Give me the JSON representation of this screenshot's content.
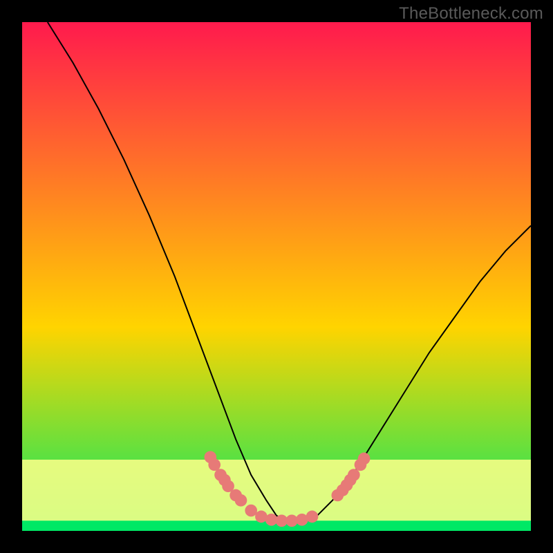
{
  "watermark": "TheBottleneck.com",
  "chart_data": {
    "type": "line",
    "title": "",
    "xlabel": "",
    "ylabel": "",
    "xlim": [
      0,
      100
    ],
    "ylim": [
      0,
      100
    ],
    "grid": false,
    "legend": false,
    "background_gradient": {
      "top_color": "#ff1a4d",
      "mid_color": "#ffd400",
      "bottom_color": "#00e865"
    },
    "series": [
      {
        "name": "curve",
        "color": "#000000",
        "x": [
          5,
          10,
          15,
          20,
          25,
          30,
          33,
          36,
          39,
          42,
          45,
          48,
          50,
          52,
          55,
          58,
          61,
          65,
          70,
          75,
          80,
          85,
          90,
          95,
          100
        ],
        "values": [
          100,
          92,
          83,
          73,
          62,
          50,
          42,
          34,
          26,
          18,
          11,
          6,
          3,
          2,
          2,
          3,
          6,
          11,
          19,
          27,
          35,
          42,
          49,
          55,
          60
        ]
      }
    ],
    "highlight_band": {
      "y_min": 0,
      "y_max": 14,
      "color": "#ffff8a"
    },
    "baseline_band": {
      "y_min": 0,
      "y_max": 2,
      "color": "#00e865"
    },
    "markers": {
      "color": "#e77a77",
      "radius": 1.2,
      "points_xy": [
        [
          37,
          14.5
        ],
        [
          37.8,
          13
        ],
        [
          39,
          11
        ],
        [
          39.8,
          10
        ],
        [
          40.5,
          8.8
        ],
        [
          42,
          7
        ],
        [
          43,
          6
        ],
        [
          45,
          4
        ],
        [
          47,
          2.8
        ],
        [
          49,
          2.2
        ],
        [
          51,
          2
        ],
        [
          53,
          2
        ],
        [
          55,
          2.2
        ],
        [
          57,
          2.8
        ],
        [
          62,
          7
        ],
        [
          63,
          8
        ],
        [
          63.8,
          9
        ],
        [
          64.5,
          10
        ],
        [
          65.2,
          11
        ],
        [
          66.5,
          13
        ],
        [
          67.2,
          14.2
        ]
      ]
    }
  }
}
